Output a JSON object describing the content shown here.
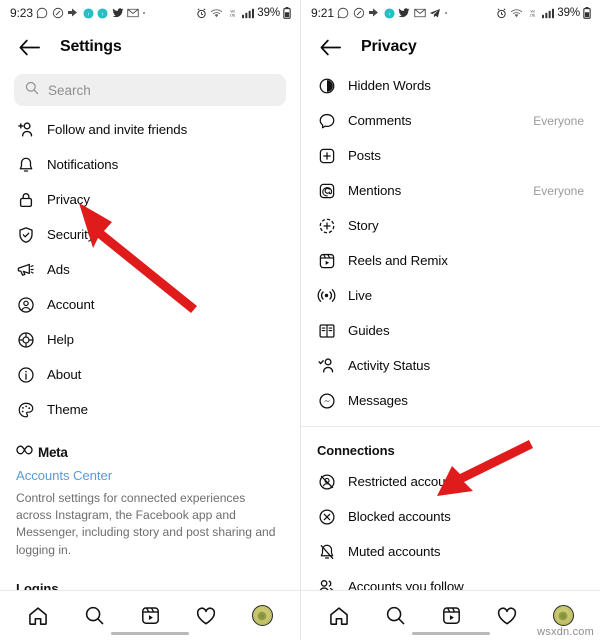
{
  "watermark": "wsxdn.com",
  "colors": {
    "arrow": "#e01b1b",
    "link": "#5b9ad6",
    "muted": "#9a9a9a",
    "search_bg": "#efefef"
  },
  "left_panel": {
    "status_bar": {
      "time": "9:23",
      "battery": "39%",
      "dot": "·"
    },
    "header": {
      "title": "Settings",
      "back_icon": "back-arrow-icon"
    },
    "search": {
      "placeholder": "Search",
      "icon": "search-icon"
    },
    "items": [
      {
        "label": "Follow and invite friends",
        "icon": "person-add-icon"
      },
      {
        "label": "Notifications",
        "icon": "bell-icon"
      },
      {
        "label": "Privacy",
        "icon": "lock-icon"
      },
      {
        "label": "Security",
        "icon": "shield-check-icon"
      },
      {
        "label": "Ads",
        "icon": "megaphone-icon"
      },
      {
        "label": "Account",
        "icon": "account-circle-icon"
      },
      {
        "label": "Help",
        "icon": "lifebuoy-icon"
      },
      {
        "label": "About",
        "icon": "info-circle-icon"
      },
      {
        "label": "Theme",
        "icon": "palette-icon"
      }
    ],
    "meta": {
      "brand": "Meta",
      "brand_icon": "meta-infinity-icon",
      "accounts_center": "Accounts Center",
      "description": "Control settings for connected experiences across Instagram, the Facebook app and Messenger, including story and post sharing and logging in."
    },
    "logins_header": "Logins"
  },
  "right_panel": {
    "status_bar": {
      "time": "9:21",
      "battery": "39%",
      "dot": "·"
    },
    "header": {
      "title": "Privacy",
      "back_icon": "back-arrow-icon"
    },
    "items": [
      {
        "label": "Hidden Words",
        "icon": "hidden-words-icon",
        "value": ""
      },
      {
        "label": "Comments",
        "icon": "comment-bubble-icon",
        "value": "Everyone"
      },
      {
        "label": "Posts",
        "icon": "plus-square-icon",
        "value": ""
      },
      {
        "label": "Mentions",
        "icon": "at-mention-icon",
        "value": "Everyone"
      },
      {
        "label": "Story",
        "icon": "story-plus-icon",
        "value": ""
      },
      {
        "label": "Reels and Remix",
        "icon": "reels-icon",
        "value": ""
      },
      {
        "label": "Live",
        "icon": "live-broadcast-icon",
        "value": ""
      },
      {
        "label": "Guides",
        "icon": "guides-book-icon",
        "value": ""
      },
      {
        "label": "Activity Status",
        "icon": "activity-status-icon",
        "value": ""
      },
      {
        "label": "Messages",
        "icon": "messenger-icon",
        "value": ""
      }
    ],
    "connections_header": "Connections",
    "connections": [
      {
        "label": "Restricted accounts",
        "icon": "restricted-account-icon"
      },
      {
        "label": "Blocked accounts",
        "icon": "blocked-account-icon"
      },
      {
        "label": "Muted accounts",
        "icon": "muted-bell-icon"
      },
      {
        "label": "Accounts you follow",
        "icon": "people-icon"
      }
    ]
  },
  "bottom_nav": {
    "items": [
      {
        "icon": "home-icon",
        "label": "Home"
      },
      {
        "icon": "search-icon",
        "label": "Search"
      },
      {
        "icon": "reels-nav-icon",
        "label": "Reels"
      },
      {
        "icon": "heart-icon",
        "label": "Activity"
      },
      {
        "icon": "profile-avatar",
        "label": "Profile"
      }
    ]
  },
  "annotations": [
    {
      "name": "arrow-pointing-to-privacy",
      "target": "Privacy"
    },
    {
      "name": "arrow-pointing-to-blocked-accounts",
      "target": "Blocked accounts"
    }
  ]
}
